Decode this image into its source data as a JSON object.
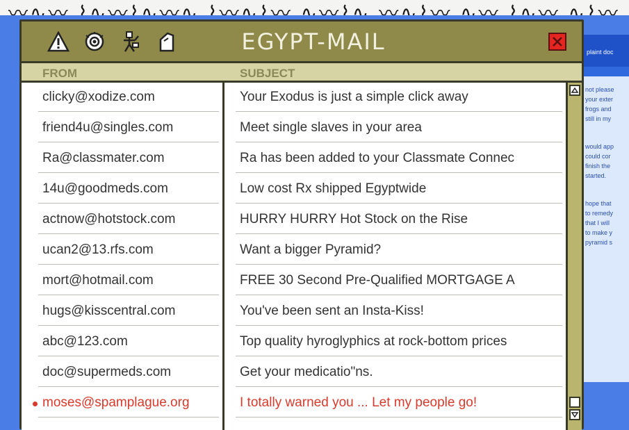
{
  "app": {
    "title": "EGYPT-MAIL"
  },
  "colors": {
    "desktop": "#4a7ee6",
    "window_frame": "#b9b56f",
    "titlebar": "#8f8a4a",
    "close": "#e42520",
    "alert": "#d83a2c"
  },
  "toolbar_icons": [
    "warning-triangle-icon",
    "eye-icon",
    "hieroglyph-figure-icon",
    "shield-icon"
  ],
  "columns": {
    "from": "FROM",
    "subject": "SUBJECT"
  },
  "emails": [
    {
      "from": "clicky@xodize.com",
      "subject": "Your Exodus is just a simple click away"
    },
    {
      "from": "friend4u@singles.com",
      "subject": "Meet single slaves in your area"
    },
    {
      "from": "Ra@classmater.com",
      "subject": "Ra has been added to your Classmate Connec"
    },
    {
      "from": "14u@goodmeds.com",
      "subject": "Low cost Rx shipped Egyptwide"
    },
    {
      "from": "actnow@hotstock.com",
      "subject": "HURRY HURRY Hot Stock on the Rise"
    },
    {
      "from": "ucan2@13.rfs.com",
      "subject": "Want a bigger Pyramid?"
    },
    {
      "from": "mort@hotmail.com",
      "subject": "FREE 30 Second Pre-Qualified MORTGAGE A"
    },
    {
      "from": "hugs@kisscentral.com",
      "subject": "You've been sent an Insta-Kiss!"
    },
    {
      "from": "abc@123.com",
      "subject": "Top quality hyroglyphics at rock-bottom prices"
    },
    {
      "from": "doc@supermeds.com",
      "subject": "Get your medicatio\"ns."
    },
    {
      "from": "moses@spamplague.org",
      "subject": "I totally warned you ... Let my people go!",
      "flagged": true
    }
  ],
  "letter": {
    "header": "plaint doc",
    "lines": [
      "not please",
      "your exter",
      "frogs and",
      "still in my",
      "would app",
      "could cor",
      "finish the",
      "started.",
      "hope that",
      "to remedy",
      "that I will",
      "to make y",
      "pyramid s"
    ]
  },
  "top_strip_text": "ꟿ ꟿ ꟿ ꟿ ꟿ"
}
